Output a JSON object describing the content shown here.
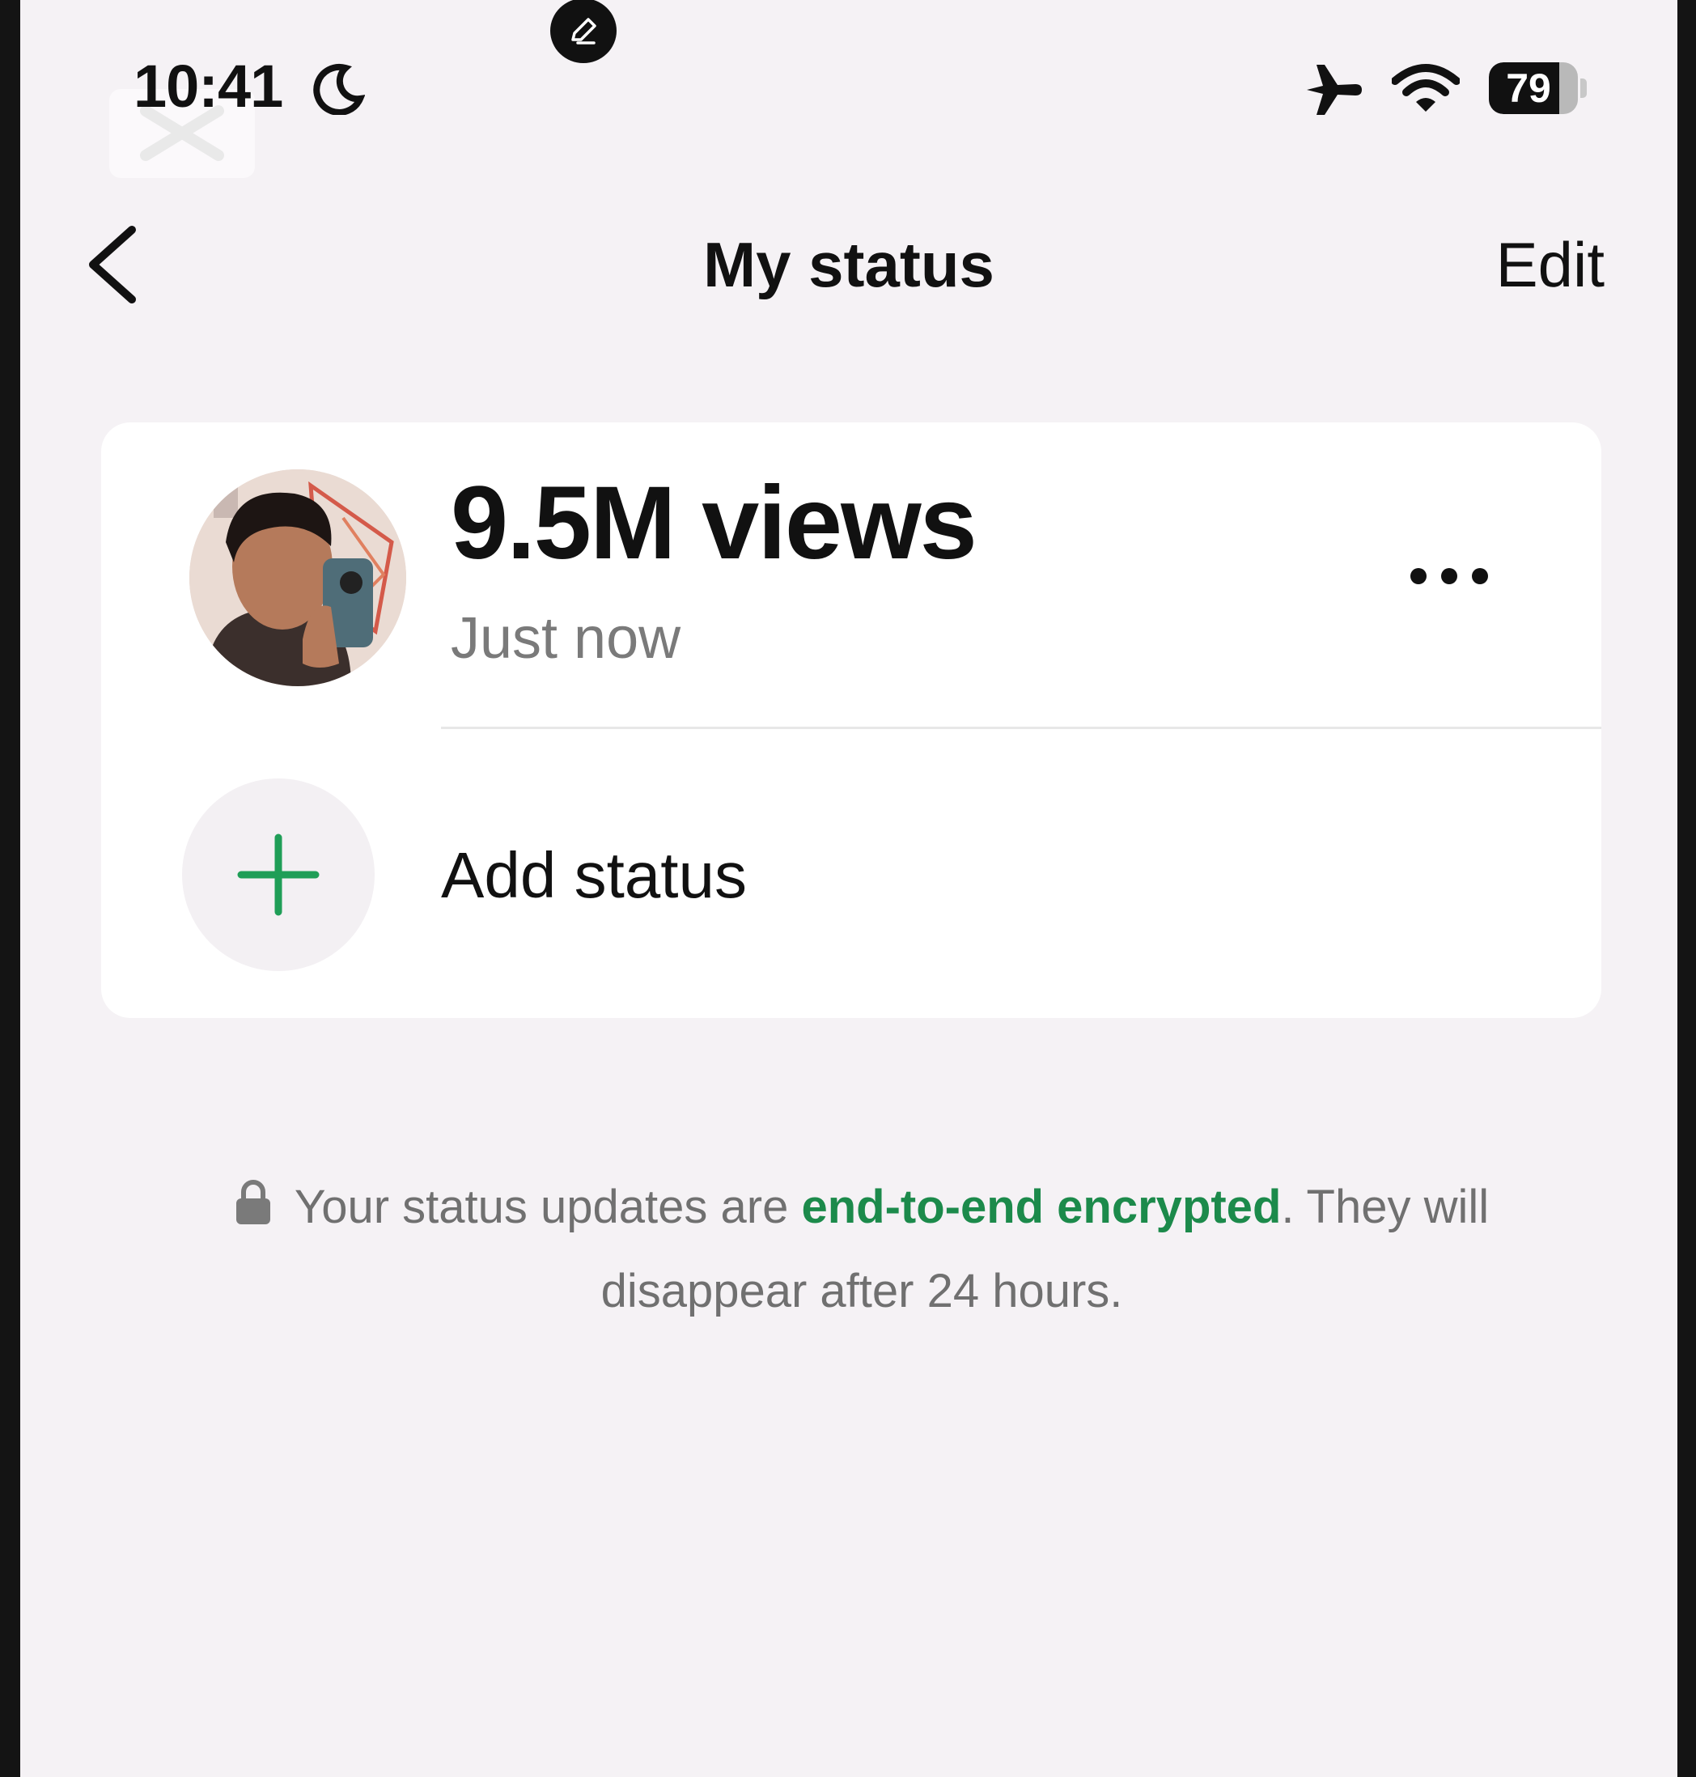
{
  "status_bar": {
    "time": "10:41",
    "battery_percent": 79,
    "battery_label": "79",
    "icons": [
      "moon-icon",
      "airplane-icon",
      "wifi-icon",
      "battery-icon",
      "edit-pen-icon"
    ]
  },
  "nav": {
    "title": "My status",
    "edit_label": "Edit",
    "back_icon": "chevron-left-icon"
  },
  "status_item": {
    "views": "9.5M views",
    "time": "Just now",
    "more_icon": "ellipsis-icon"
  },
  "add_status": {
    "label": "Add status",
    "icon": "plus-icon",
    "accent": "#1f9e57"
  },
  "footer": {
    "prefix": "Your status updates are ",
    "link": "end-to-end encrypted",
    "suffix": ". They will disappear after 24 hours.",
    "link_color": "#1c8a4b"
  }
}
